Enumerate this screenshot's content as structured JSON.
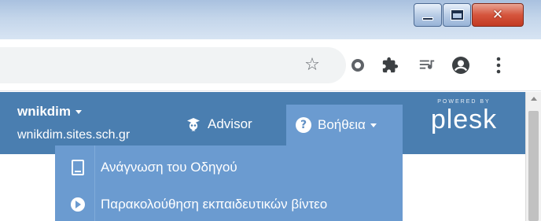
{
  "window": {
    "minimize_glyph": "",
    "close_glyph": "✕"
  },
  "toolbar": {
    "icons": [
      "star-icon",
      "ring-icon",
      "puzzle-icon",
      "queue-icon",
      "account-icon",
      "menu-icon"
    ]
  },
  "header": {
    "user_name": "wnikdim",
    "user_domain": "wnikdim.sites.sch.gr",
    "advisor_label": "Advisor",
    "help_label": "Βοήθεια",
    "help_glyph": "?",
    "powered_by": "POWERED BY",
    "logo": "plesk"
  },
  "help_menu": {
    "items": [
      {
        "label": "Ανάγνωση του Οδηγού",
        "icon": "book-icon"
      },
      {
        "label": "Παρακολούθηση εκπαιδευτικών βίντεο",
        "icon": "play-icon"
      }
    ]
  },
  "colors": {
    "header_bg": "#4a7eb0",
    "menu_bg": "#6b9bd0",
    "titlebar": "#c3d5ea",
    "close_button": "#d5553d"
  }
}
